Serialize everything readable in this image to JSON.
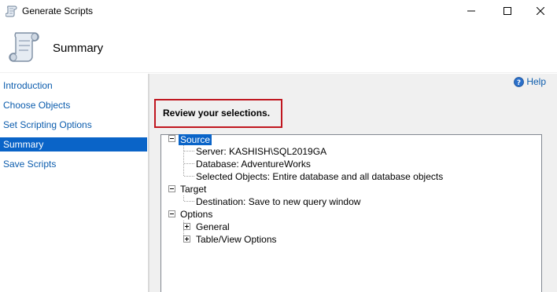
{
  "window": {
    "title": "Generate Scripts",
    "controls": [
      "minimize-icon",
      "maximize-icon",
      "close-icon"
    ]
  },
  "header": {
    "title": "Summary",
    "icon": "scroll-icon"
  },
  "sidebar": {
    "items": [
      {
        "label": "Introduction",
        "active": false
      },
      {
        "label": "Choose Objects",
        "active": false
      },
      {
        "label": "Set Scripting Options",
        "active": false
      },
      {
        "label": "Summary",
        "active": true
      },
      {
        "label": "Save Scripts",
        "active": false
      }
    ]
  },
  "main": {
    "help_label": "Help",
    "review_label": "Review your selections.",
    "tree": {
      "source": {
        "label": "Source",
        "children": [
          "Server: KASHISH\\SQL2019GA",
          "Database: AdventureWorks",
          "Selected Objects: Entire database and all database objects"
        ]
      },
      "target": {
        "label": "Target",
        "children": [
          "Destination: Save to new query window"
        ]
      },
      "options": {
        "label": "Options",
        "children": [
          "General",
          "Table/View Options"
        ]
      }
    }
  },
  "colors": {
    "link": "#0b5cad",
    "selection": "#0a64c8",
    "highlight_border": "#c0161f",
    "panel_bg": "#f0f0f0"
  }
}
